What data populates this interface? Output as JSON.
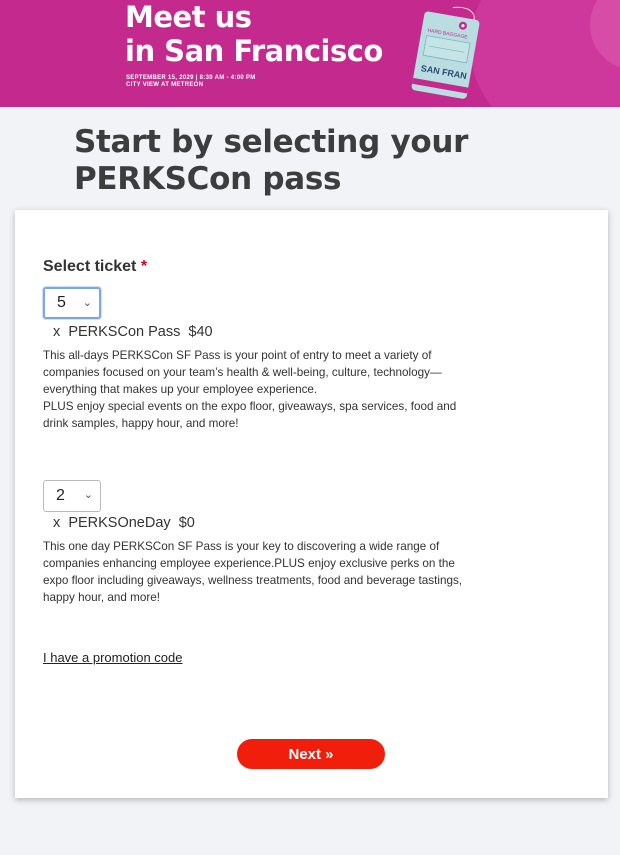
{
  "banner": {
    "title_line1": "Meet us",
    "title_line2": "in San Francisco",
    "date_line": "SEPTEMBER 15, 2029 | 8:30 AM - 4:00 PM",
    "venue_line": "CITY VIEW AT METREON",
    "tag_small": "HARD BAGGAGE",
    "tag_main": "SAN FRAN"
  },
  "page": {
    "title_line1": "Start by selecting your",
    "title_line2": "PERKSCon pass"
  },
  "form": {
    "select_label": "Select ticket",
    "required_marker": "*",
    "tickets": [
      {
        "quantity": "5",
        "multiplier": "x",
        "name": "PERKSCon Pass",
        "price": "$40",
        "desc_line1": "This all-days PERKSCon SF Pass is your point of entry to meet a variety of",
        "desc_line2": "companies focused on your team’s health & well-being, culture, technology—",
        "desc_line3": "everything that makes up your employee experience.",
        "desc_line4": "PLUS enjoy special events on the expo floor, giveaways, spa services, food and",
        "desc_line5": "drink samples, happy hour, and more!"
      },
      {
        "quantity": "2",
        "multiplier": "x",
        "name": "PERKSOneDay",
        "price": "$0",
        "desc_line1": "This one day PERKSCon SF Pass is your key to discovering a wide range of",
        "desc_line2": "companies enhancing employee experience.PLUS enjoy exclusive perks on the",
        "desc_line3": "expo floor including giveaways, wellness treatments, food and beverage tastings,",
        "desc_line4": "happy hour, and more!"
      }
    ],
    "promo_link": "I have a promotion code",
    "next_button": "Next »"
  },
  "colors": {
    "banner": "#c42a8e",
    "button": "#f01e0a",
    "required": "#d0021b"
  },
  "icons": {
    "dropdown": "chevron-down-icon",
    "tag": "luggage-tag-icon"
  }
}
